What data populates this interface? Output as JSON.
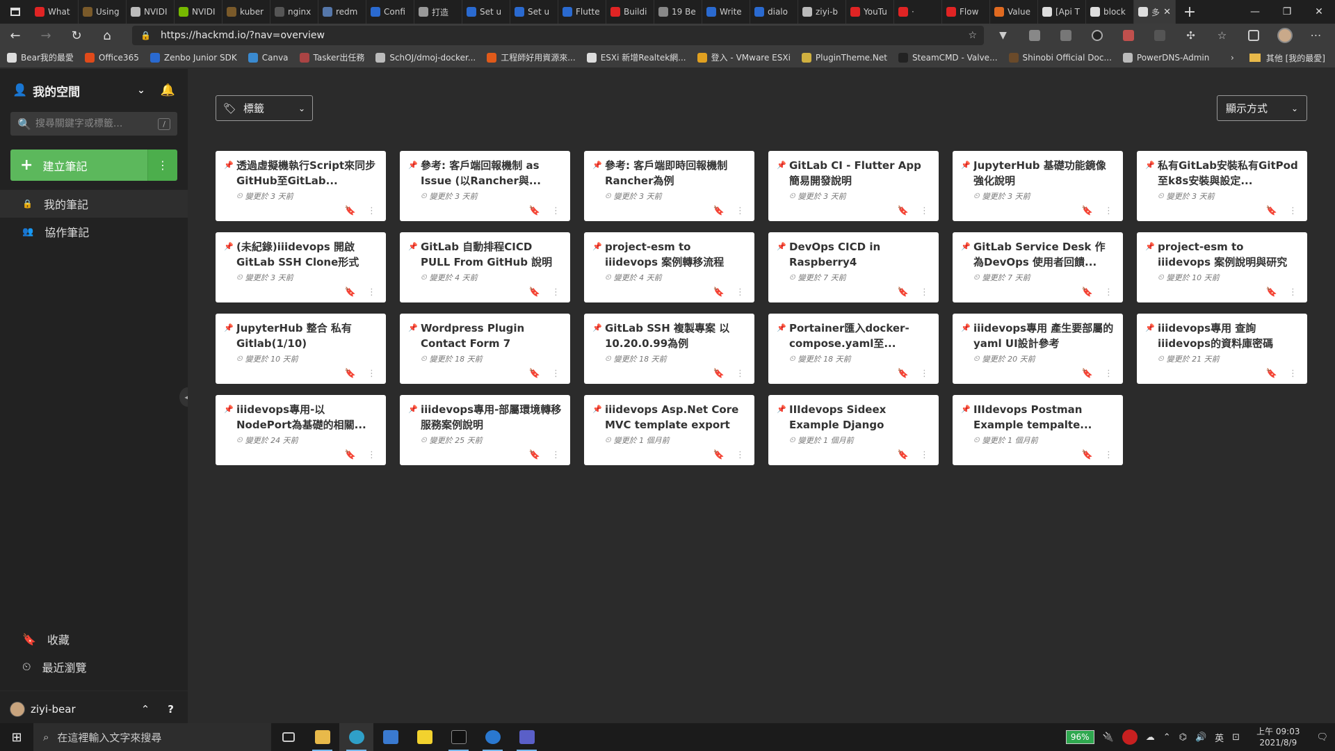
{
  "browser": {
    "tabs": [
      {
        "label": "What",
        "color": "#e02424"
      },
      {
        "label": "Using",
        "color": "#7a5a2a"
      },
      {
        "label": "NVIDI",
        "color": "#bbbbbb"
      },
      {
        "label": "NVIDI",
        "color": "#76b900"
      },
      {
        "label": "kuber",
        "color": "#7a5a2a"
      },
      {
        "label": "nginx",
        "color": "#555555"
      },
      {
        "label": "redm",
        "color": "#5577aa"
      },
      {
        "label": "Confi",
        "color": "#2a6ad0"
      },
      {
        "label": "打造",
        "color": "#999999"
      },
      {
        "label": "Set u",
        "color": "#2a6ad0"
      },
      {
        "label": "Set u",
        "color": "#2a6ad0"
      },
      {
        "label": "Flutte",
        "color": "#2a6ad0"
      },
      {
        "label": "Buildi",
        "color": "#e02424"
      },
      {
        "label": "19 Be",
        "color": "#888888"
      },
      {
        "label": "Write",
        "color": "#2a6ad0"
      },
      {
        "label": "dialo",
        "color": "#2a6ad0"
      },
      {
        "label": "ziyi-b",
        "color": "#bbbbbb"
      },
      {
        "label": "YouTu",
        "color": "#e02424"
      },
      {
        "label": "· ",
        "color": "#e02424"
      },
      {
        "label": "Flow",
        "color": "#e02424"
      },
      {
        "label": "Value",
        "color": "#e06a20"
      },
      {
        "label": "[Api T",
        "color": "#dddddd"
      },
      {
        "label": "block",
        "color": "#dddddd"
      }
    ],
    "active_tab_label": "多",
    "url": "https://hackmd.io/?nav=overview"
  },
  "bookmarks": [
    {
      "label": "Bear我的最愛",
      "color": "#dddddd"
    },
    {
      "label": "Office365",
      "color": "#e04a1a"
    },
    {
      "label": "Zenbo Junior SDK",
      "color": "#2a6ad0"
    },
    {
      "label": "Canva",
      "color": "#3a8ad0"
    },
    {
      "label": "Tasker出任務",
      "color": "#aa4444"
    },
    {
      "label": "SchOJ/dmoj-docker...",
      "color": "#bbbbbb"
    },
    {
      "label": "工程師好用資源來...",
      "color": "#e05a1a"
    },
    {
      "label": "ESXi 新增Realtek網...",
      "color": "#dddddd"
    },
    {
      "label": "登入 - VMware ESXi",
      "color": "#e0a020"
    },
    {
      "label": "PluginTheme.Net",
      "color": "#d0b040"
    },
    {
      "label": "SteamCMD - Valve...",
      "color": "#222222"
    },
    {
      "label": "Shinobi Official Doc...",
      "color": "#6a4a2a"
    },
    {
      "label": "PowerDNS-Admin",
      "color": "#bbbbbb"
    }
  ],
  "bookmarks_other": "其他 [我的最愛]",
  "sidebar": {
    "space_title": "我的空間",
    "search_placeholder": "搜尋關鍵字或標籤...",
    "search_shortcut": "/",
    "new_note": "建立筆記",
    "items": [
      {
        "label": "我的筆記",
        "icon": "lock-icon"
      },
      {
        "label": "協作筆記",
        "icon": "users-icon"
      }
    ],
    "bottom_items": [
      {
        "label": "收藏",
        "icon": "bookmark-icon"
      },
      {
        "label": "最近瀏覽",
        "icon": "clock-icon"
      }
    ],
    "username": "ziyi-bear",
    "help": "?"
  },
  "toolbar": {
    "tags_label": "標籤",
    "view_label": "顯示方式"
  },
  "notes": [
    {
      "title": "透過虛擬機執行Script來同步GitHub至GitLab...",
      "updated": "變更於 3 天前"
    },
    {
      "title": "參考: 客戶端回報機制 as Issue (以Rancher與...",
      "updated": "變更於 3 天前"
    },
    {
      "title": "參考: 客戶端即時回報機制 Rancher為例",
      "updated": "變更於 3 天前"
    },
    {
      "title": "GitLab CI - Flutter App 簡易開發說明",
      "updated": "變更於 3 天前"
    },
    {
      "title": "JupyterHub 基礎功能鏡像強化說明",
      "updated": "變更於 3 天前"
    },
    {
      "title": "私有GitLab安裝私有GitPod至k8s安裝與設定...",
      "updated": "變更於 3 天前"
    },
    {
      "title": "(未紀錄)iiidevops 開啟GitLab SSH Clone形式",
      "updated": "變更於 3 天前"
    },
    {
      "title": "GitLab 自動排程CICD PULL From GitHub 說明",
      "updated": "變更於 4 天前"
    },
    {
      "title": "project-esm to iiidevops 案例轉移流程",
      "updated": "變更於 4 天前"
    },
    {
      "title": "DevOps CICD in Raspberry4",
      "updated": "變更於 7 天前"
    },
    {
      "title": "GitLab Service Desk 作為DevOps 使用者回饋...",
      "updated": "變更於 7 天前"
    },
    {
      "title": "project-esm to iiidevops 案例說明與研究(包含...",
      "updated": "變更於 10 天前"
    },
    {
      "title": "JupyterHub 整合 私有Gitlab(1/10)",
      "updated": "變更於 10 天前"
    },
    {
      "title": "Wordpress Plugin Contact Form 7",
      "updated": "變更於 18 天前"
    },
    {
      "title": "GitLab SSH 複製專案 以10.20.0.99為例",
      "updated": "變更於 18 天前"
    },
    {
      "title": "Portainer匯入docker-compose.yaml至...",
      "updated": "變更於 18 天前"
    },
    {
      "title": "iiidevops專用 產生要部屬的yaml UI設計參考",
      "updated": "變更於 20 天前"
    },
    {
      "title": "iiidevops專用 查詢iiidevops的資料庫密碼",
      "updated": "變更於 21 天前"
    },
    {
      "title": "iiidevops專用-以NodePort為基礎的相關...",
      "updated": "變更於 24 天前"
    },
    {
      "title": "iiidevops專用-部屬環境轉移服務案例說明",
      "updated": "變更於 25 天前"
    },
    {
      "title": "iiidevops Asp.Net Core MVC template export",
      "updated": "變更於 1 個月前"
    },
    {
      "title": "IIIdevops Sideex Example Django maria...",
      "updated": "變更於 1 個月前"
    },
    {
      "title": "IIIdevops Postman Example tempalte...",
      "updated": "變更於 1 個月前"
    }
  ],
  "taskbar": {
    "search_placeholder": "在這裡輸入文字來搜尋",
    "battery": "96%",
    "ime": "英",
    "time": "上午 09:03",
    "date": "2021/8/9"
  }
}
